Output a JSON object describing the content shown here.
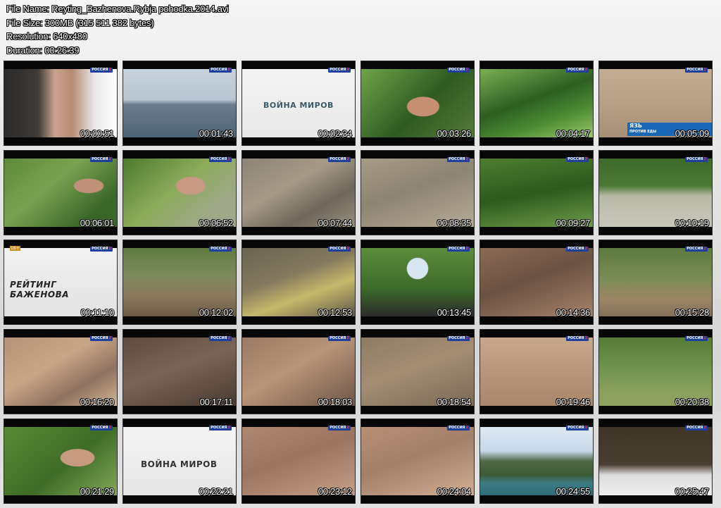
{
  "header": {
    "file_name": "File Name: Reyting_Bazhenova.Rybja pohodka.2014.avi",
    "file_size": "File Size: 300MB (315 511 382 bytes)",
    "resolution": "Resolution: 640x480",
    "duration": "Duration: 00:26:39"
  },
  "channel_logo": {
    "text": "РОССИЯ",
    "num": "2"
  },
  "title_cards": {
    "voina_mirov": "ВОЙНА МИРОВ",
    "reyting": "РЕЙТИНГ БАЖЕНОВА"
  },
  "caption": {
    "line1": "ЯЗЬ",
    "line2": "ПРОТИВ ЕДЫ"
  },
  "age_badge": "16+",
  "colors": {
    "logo_blue": "#1f3f9c",
    "caption_blue": "#1a68b5"
  },
  "thumbnails": [
    {
      "time": "00:00:51",
      "scene": "car"
    },
    {
      "time": "00:01:43",
      "scene": "sea"
    },
    {
      "time": "00:02:34",
      "scene": "title-voina"
    },
    {
      "time": "00:03:26",
      "scene": "jungle-face"
    },
    {
      "time": "00:04:17",
      "scene": "jungle-walk"
    },
    {
      "time": "00:05:09",
      "scene": "mud-caption"
    },
    {
      "time": "00:06:01",
      "scene": "jungle-crouch"
    },
    {
      "time": "00:06:52",
      "scene": "jungle-face2"
    },
    {
      "time": "00:07:44",
      "scene": "lizard"
    },
    {
      "time": "00:08:35",
      "scene": "lizard2"
    },
    {
      "time": "00:09:27",
      "scene": "jungle-lizard"
    },
    {
      "time": "00:10:19",
      "scene": "lizard-field"
    },
    {
      "time": "00:11:10",
      "scene": "title-reyting"
    },
    {
      "time": "00:12:02",
      "scene": "mangrove-sit"
    },
    {
      "time": "00:12:53",
      "scene": "mud-legs"
    },
    {
      "time": "00:13:45",
      "scene": "canopy"
    },
    {
      "time": "00:14:36",
      "scene": "roots"
    },
    {
      "time": "00:15:28",
      "scene": "mangrove-forest"
    },
    {
      "time": "00:16:20",
      "scene": "mud-dig"
    },
    {
      "time": "00:17:11",
      "scene": "roots-dark"
    },
    {
      "time": "00:18:03",
      "scene": "climb"
    },
    {
      "time": "00:18:54",
      "scene": "mud-crab"
    },
    {
      "time": "00:19:46",
      "scene": "mud-flat"
    },
    {
      "time": "00:20:38",
      "scene": "forest-stand"
    },
    {
      "time": "00:21:29",
      "scene": "green-face"
    },
    {
      "time": "00:22:21",
      "scene": "title-voina2"
    },
    {
      "time": "00:23:12",
      "scene": "roots-feet"
    },
    {
      "time": "00:24:04",
      "scene": "roots-climb"
    },
    {
      "time": "00:24:55",
      "scene": "island"
    },
    {
      "time": "00:25:47",
      "scene": "snow-car"
    }
  ]
}
